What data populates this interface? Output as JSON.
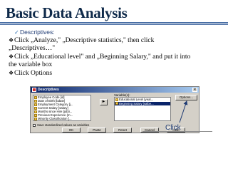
{
  "slide": {
    "title": "Basic Data Analysis",
    "lines": [
      {
        "mark": "✓",
        "text": "Descriptives:"
      },
      {
        "mark": "❖",
        "text": "Click „Analyze,\" „Descriptive statistics,\" then click"
      },
      {
        "mark": "",
        "text": "„Descriptives…\""
      },
      {
        "mark": "❖",
        "text": "Click „Educational level\" and „Beginning Salary,\" and put it into"
      },
      {
        "mark": "",
        "text": "the variable box"
      },
      {
        "mark": "❖",
        "text": "Click Options"
      }
    ],
    "click_label": "Click"
  },
  "dialog": {
    "title": "Descriptives",
    "close_glyph": "✕",
    "arrow_glyph": "►",
    "source_variables": [
      "Employee Code [id]",
      "Date of Birth [bdate]",
      "Employment Category [j...",
      "Current Salary [salary]",
      "Months since Hire [jobti...",
      "Previous Experience (m...",
      "Minority Classification [..."
    ],
    "variables_label": "Variable(s):",
    "selected_variables": [
      "Educational Level (year...",
      "Beginning Salary [salbe..."
    ],
    "options_label": "Options...",
    "save_checkbox_label": "Save standardized values as variables",
    "buttons": [
      "OK",
      "Paste",
      "Reset",
      "Cancel",
      "Help"
    ]
  },
  "colors": {
    "title": "#0f2a4a",
    "rule": "#4a6fa5",
    "dialog_face": "#d4d0c8",
    "titlebar": "#0a246a",
    "click_text": "#1f3b73"
  }
}
